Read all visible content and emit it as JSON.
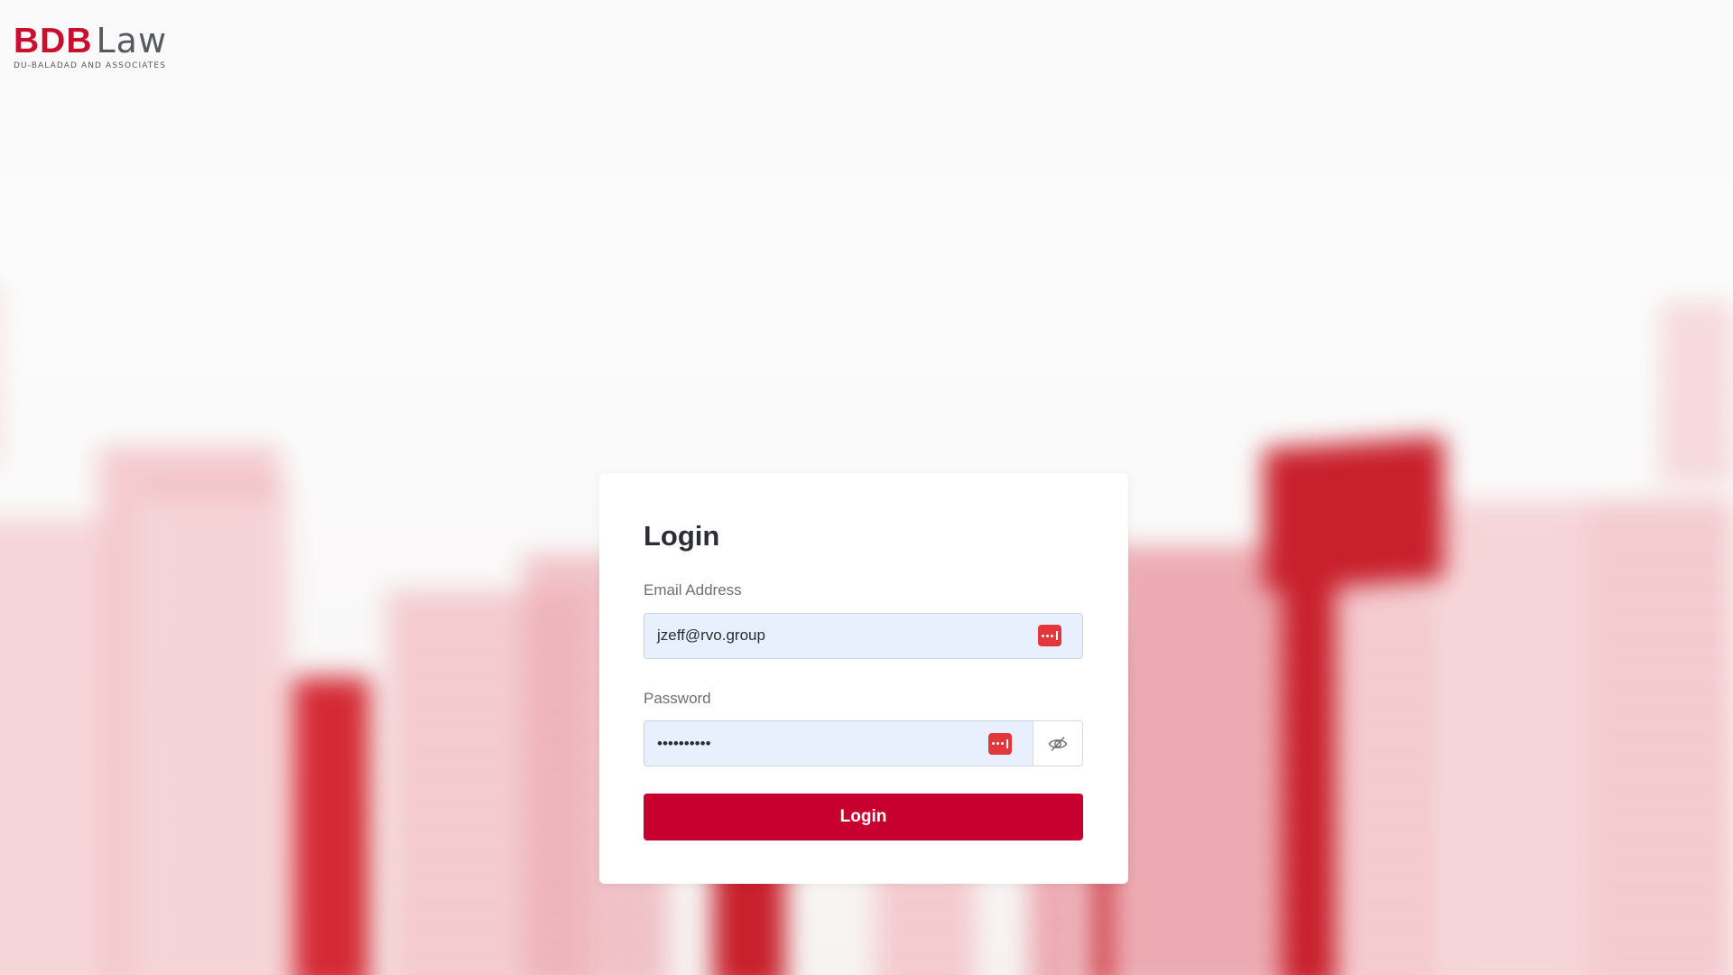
{
  "brand": {
    "logo_primary": "BDB",
    "logo_secondary": "Law",
    "logo_tagline": "DU-BALADAD AND ASSOCIATES",
    "primary_color": "#c8102e",
    "secondary_color": "#555a60"
  },
  "login": {
    "title": "Login",
    "email_label": "Email Address",
    "email_value": "jzeff@rvo.group",
    "password_label": "Password",
    "password_value": "••••••••••",
    "submit_label": "Login",
    "button_color": "#c8002f"
  },
  "icons": {
    "password_manager": "password-manager-icon",
    "toggle_visibility": "eye-slash-icon"
  }
}
